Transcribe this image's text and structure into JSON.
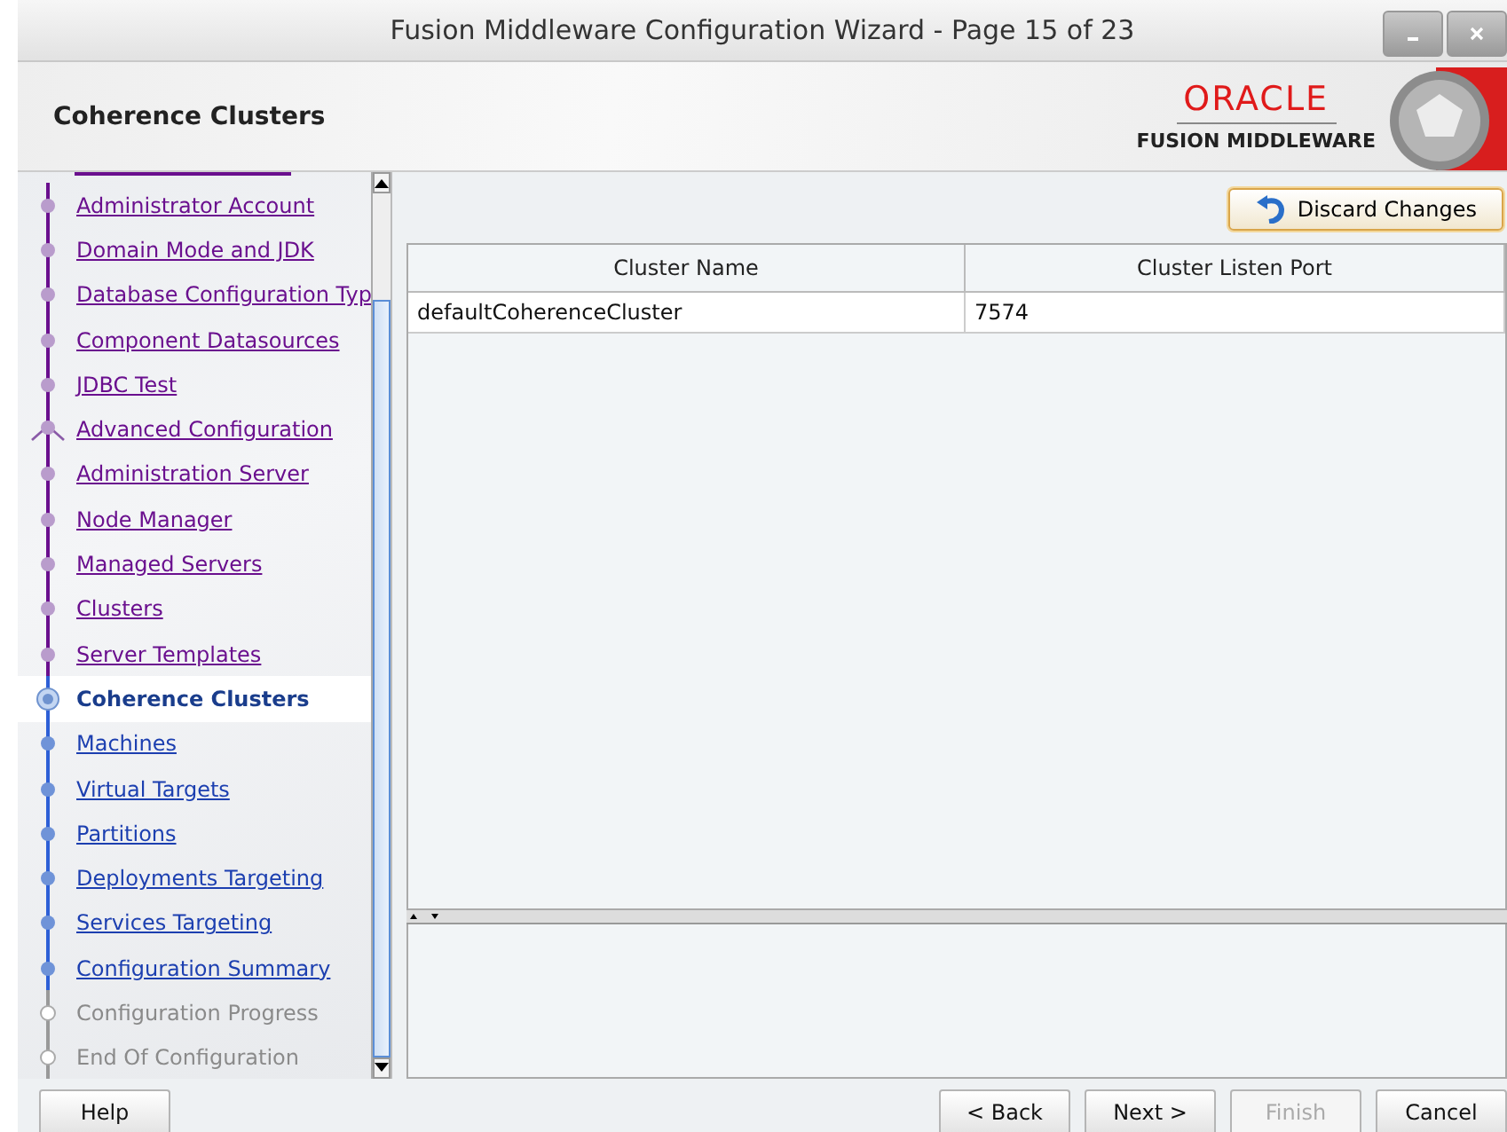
{
  "window": {
    "title": "Fusion Middleware Configuration Wizard - Page 15 of 23"
  },
  "header": {
    "title": "Coherence Clusters",
    "brand": "ORACLE",
    "product": "FUSION MIDDLEWARE"
  },
  "steps": [
    {
      "label": "Administrator Account",
      "kind": "visited",
      "selected": false,
      "branch": false
    },
    {
      "label": "Domain Mode and JDK",
      "kind": "visited",
      "selected": false,
      "branch": false
    },
    {
      "label": "Database Configuration Typ",
      "kind": "visited",
      "selected": false,
      "branch": false
    },
    {
      "label": "Component Datasources",
      "kind": "visited",
      "selected": false,
      "branch": false
    },
    {
      "label": "JDBC Test",
      "kind": "visited",
      "selected": false,
      "branch": false
    },
    {
      "label": "Advanced Configuration",
      "kind": "visited",
      "selected": false,
      "branch": true
    },
    {
      "label": "Administration Server",
      "kind": "visited",
      "selected": false,
      "branch": false
    },
    {
      "label": "Node Manager",
      "kind": "visited",
      "selected": false,
      "branch": false
    },
    {
      "label": "Managed Servers",
      "kind": "visited",
      "selected": false,
      "branch": false
    },
    {
      "label": "Clusters",
      "kind": "visited",
      "selected": false,
      "branch": false
    },
    {
      "label": "Server Templates",
      "kind": "visited",
      "selected": false,
      "branch": false
    },
    {
      "label": "Coherence Clusters",
      "kind": "pending",
      "selected": true,
      "branch": false
    },
    {
      "label": "Machines",
      "kind": "pending",
      "selected": false,
      "branch": false
    },
    {
      "label": "Virtual Targets",
      "kind": "pending",
      "selected": false,
      "branch": false
    },
    {
      "label": "Partitions",
      "kind": "pending",
      "selected": false,
      "branch": false
    },
    {
      "label": "Deployments Targeting",
      "kind": "pending",
      "selected": false,
      "branch": false
    },
    {
      "label": "Services Targeting",
      "kind": "pending",
      "selected": false,
      "branch": false
    },
    {
      "label": "Configuration Summary",
      "kind": "pending",
      "selected": false,
      "branch": false
    },
    {
      "label": "Configuration Progress",
      "kind": "disabled",
      "selected": false,
      "branch": false
    },
    {
      "label": "End Of Configuration",
      "kind": "disabled",
      "selected": false,
      "branch": false
    }
  ],
  "discard_button": {
    "label": "Discard Changes"
  },
  "table": {
    "columns": [
      "Cluster Name",
      "Cluster Listen Port"
    ],
    "rows": [
      [
        "defaultCoherenceCluster",
        "7574"
      ]
    ]
  },
  "buttons": [
    {
      "label": "Help",
      "disabled": false,
      "kind": "left"
    },
    {
      "label": "< Back",
      "disabled": false,
      "kind": "right"
    },
    {
      "label": "Next >",
      "disabled": false,
      "kind": "right"
    },
    {
      "label": "Finish",
      "disabled": true,
      "kind": "right"
    },
    {
      "label": "Cancel",
      "disabled": false,
      "kind": "right"
    }
  ]
}
